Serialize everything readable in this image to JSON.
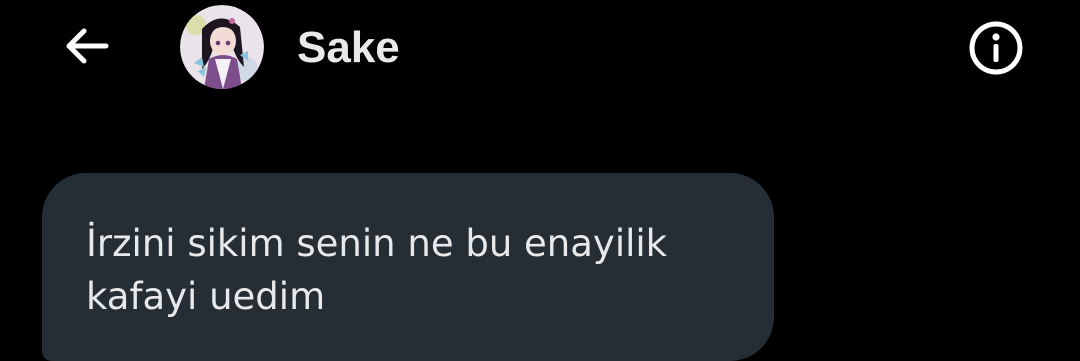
{
  "header": {
    "back_icon": "arrow-left-icon",
    "contact_name": "Sake",
    "avatar_icon": "anime-avatar",
    "info_icon": "info-circle-icon"
  },
  "messages": [
    {
      "direction": "incoming",
      "text": "İrzini sikim senin ne bu enayilik kafayi uedim"
    }
  ],
  "colors": {
    "background": "#000000",
    "bubble_incoming": "#252d35",
    "text": "#e7e9ea",
    "icon": "#ffffff"
  }
}
